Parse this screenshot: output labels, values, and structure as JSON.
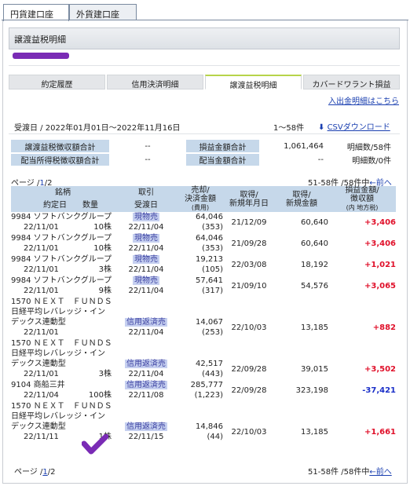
{
  "tabs": {
    "yen": "円貨建口座",
    "foreign": "外貨建口座"
  },
  "page_title": "譲渡益税明細",
  "subtabs": [
    "約定履歴",
    "信用決済明細",
    "譲渡益税明細",
    "カバードワラント損益"
  ],
  "io_link": "入出金明細はこちら",
  "period": "受渡日 / 2022年01月01日〜2022年11月16日",
  "count": "1〜58件",
  "csv": "CSVダウンロード",
  "summary": [
    {
      "l1": "譲渡益税徴収額合計",
      "v1": "--",
      "l2": "損益金額合計",
      "v2": "1,061,464",
      "c": "明細数/58件"
    },
    {
      "l1": "配当所得税徴収額合計",
      "v1": "--",
      "l2": "配当金額合計",
      "v2": "--",
      "c": "明細数/0件"
    }
  ],
  "pager": {
    "prefix": "ページ /",
    "current": "1",
    "sep": "/",
    "total": "2",
    "range": "51-58件 /58件中",
    "prev": "←前へ"
  },
  "headers": {
    "meigara": "銘柄",
    "yakujo": "約定日",
    "suryo": "数量",
    "torihiki": "取引",
    "ukewatashi": "受渡日",
    "baikyaku1": "売却/",
    "baikyaku2": "決済金額",
    "baikyaku3": "(費用)",
    "shutoku1": "取得/",
    "shutoku2": "新規年月日",
    "shutokugaku1": "取得/",
    "shutokugaku2": "新規金額",
    "soneki1": "損益金額/",
    "soneki2": "徴収額",
    "soneki3": "(内 地方税)"
  },
  "rows": [
    {
      "name": [
        "9984 ソフトバンクグループ"
      ],
      "trade_date": "22/11/01",
      "qty": "10株",
      "type": "現物売",
      "settle": "22/11/04",
      "amount": "64,046",
      "cost": "(353)",
      "acq_date": "21/12/09",
      "acq_amount": "60,640",
      "pl": "+3,406",
      "sign": "gain"
    },
    {
      "name": [
        "9984 ソフトバンクグループ"
      ],
      "trade_date": "22/11/01",
      "qty": "10株",
      "type": "現物売",
      "settle": "22/11/04",
      "amount": "64,046",
      "cost": "(353)",
      "acq_date": "21/09/28",
      "acq_amount": "60,640",
      "pl": "+3,406",
      "sign": "gain"
    },
    {
      "name": [
        "9984 ソフトバンクグループ"
      ],
      "trade_date": "22/11/01",
      "qty": "3株",
      "type": "現物売",
      "settle": "22/11/04",
      "amount": "19,213",
      "cost": "(105)",
      "acq_date": "22/03/08",
      "acq_amount": "18,192",
      "pl": "+1,021",
      "sign": "gain"
    },
    {
      "name": [
        "9984 ソフトバンクグループ"
      ],
      "trade_date": "22/11/01",
      "qty": "9株",
      "type": "現物売",
      "settle": "22/11/04",
      "amount": "57,641",
      "cost": "(317)",
      "acq_date": "21/09/10",
      "acq_amount": "54,576",
      "pl": "+3,065",
      "sign": "gain"
    },
    {
      "name": [
        "1570 ＮＥＸＴ　ＦＵＮＤＳ",
        "日経平均レバレッジ・イン",
        "デックス連動型"
      ],
      "trade_date": "22/11/01",
      "qty": "",
      "type": "信用返済売",
      "settle": "22/11/04",
      "amount": "14,067",
      "cost": "(253)",
      "acq_date": "22/10/03",
      "acq_amount": "13,185",
      "pl": "+882",
      "sign": "gain"
    },
    {
      "name": [
        "1570 ＮＥＸＴ　ＦＵＮＤＳ",
        "日経平均レバレッジ・イン",
        "デックス連動型"
      ],
      "trade_date": "22/11/01",
      "qty": "3株",
      "type": "信用返済売",
      "settle": "22/11/04",
      "amount": "42,517",
      "cost": "(443)",
      "acq_date": "22/09/28",
      "acq_amount": "39,015",
      "pl": "+3,502",
      "sign": "gain"
    },
    {
      "name": [
        "9104 商船三井"
      ],
      "trade_date": "22/11/04",
      "qty": "100株",
      "type": "信用返済売",
      "settle": "22/11/08",
      "amount": "285,777",
      "cost": "(1,223)",
      "acq_date": "22/09/28",
      "acq_amount": "323,198",
      "pl": "-37,421",
      "sign": "loss"
    },
    {
      "name": [
        "1570 ＮＥＸＴ　ＦＵＮＤＳ",
        "日経平均レバレッジ・イン",
        "デックス連動型"
      ],
      "trade_date": "22/11/11",
      "qty": "1株",
      "type": "信用返済売",
      "settle": "22/11/15",
      "amount": "14,846",
      "cost": "(44)",
      "acq_date": "22/10/03",
      "acq_amount": "13,185",
      "pl": "+1,661",
      "sign": "gain"
    }
  ]
}
